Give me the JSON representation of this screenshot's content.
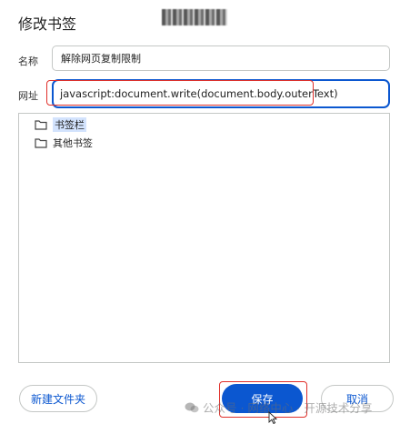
{
  "dialog": {
    "title": "修改书签"
  },
  "name_field": {
    "label": "名称",
    "value": "解除网页复制限制"
  },
  "url_field": {
    "label": "网址",
    "value": "javascript:document.write(document.body.outerText)"
  },
  "folders": [
    {
      "label": "书签栏",
      "selected": true
    },
    {
      "label": "其他书签",
      "selected": false
    }
  ],
  "buttons": {
    "new_folder": "新建文件夹",
    "save": "保存",
    "cancel": "取消"
  },
  "watermark": {
    "text": "公众号 · 网络中心 · 开源技术分享"
  },
  "colors": {
    "accent": "#0b57d0",
    "selection": "#d3e3fd",
    "highlight_annotation": "#e0302a"
  }
}
